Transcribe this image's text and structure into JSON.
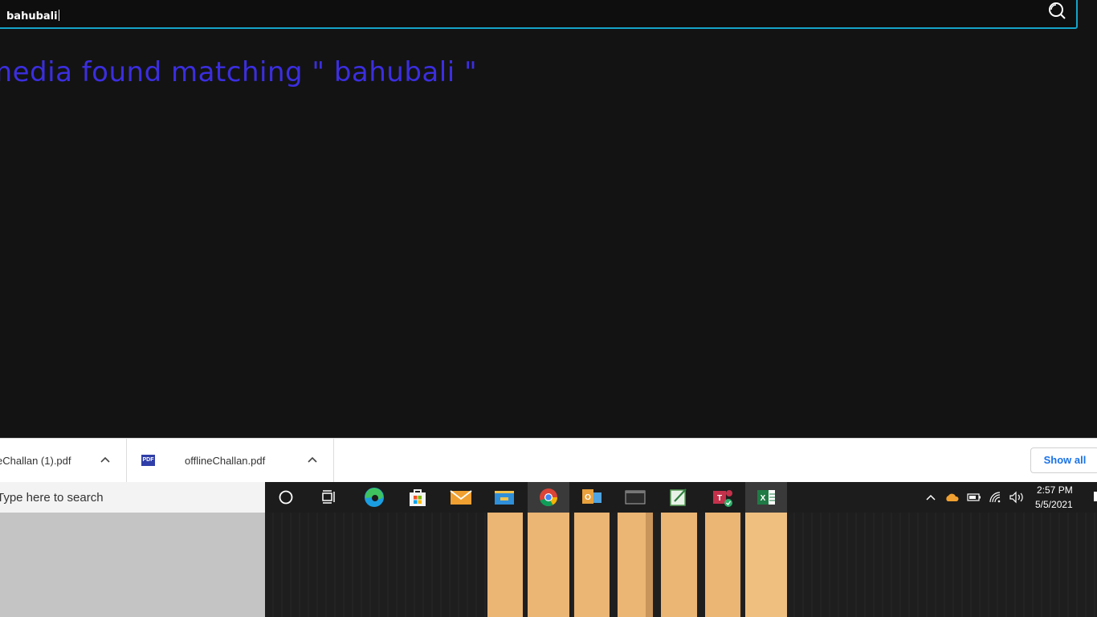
{
  "search": {
    "value": "bahubali"
  },
  "result": {
    "message": "media found matching \" bahubali \""
  },
  "downloads": {
    "items": [
      {
        "name": "eChallan (1).pdf"
      },
      {
        "name": "offlineChallan.pdf",
        "badge": "PDF"
      }
    ],
    "show_all_label": "Show all"
  },
  "taskbar": {
    "search_placeholder": "Type here to search",
    "apps": [
      "cortana-icon",
      "task-view-icon",
      "edge-icon",
      "store-icon",
      "mail-icon",
      "file-explorer-icon",
      "chrome-icon",
      "outlook-icon",
      "terminal-icon",
      "notepad-icon",
      "teams-icon",
      "excel-icon"
    ],
    "clock": {
      "time": "2:57 PM",
      "date": "5/5/2021"
    }
  },
  "colors": {
    "accent": "#16a3c9",
    "message": "#3b2ee0",
    "link": "#1a73e8",
    "peach": "#ebb574"
  }
}
